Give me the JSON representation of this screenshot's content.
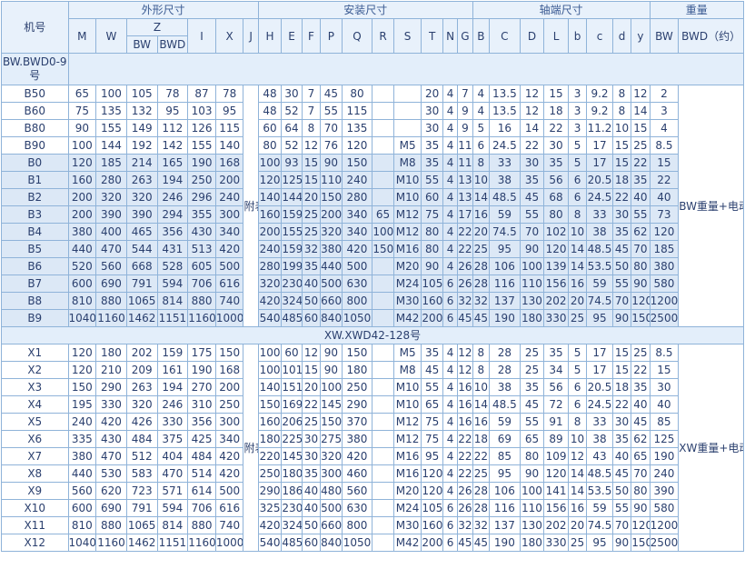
{
  "headers": {
    "model": "机号",
    "group_outer": "外形尺寸",
    "group_install": "安装尺寸",
    "group_shaft": "轴端尺寸",
    "group_weight": "重量",
    "M": "M",
    "W": "W",
    "Z": "Z",
    "Z_BW": "BW",
    "Z_BWD": "BWD",
    "I": "I",
    "X": "X",
    "J": "J",
    "H": "H",
    "E": "E",
    "F": "F",
    "P": "P",
    "Q": "Q",
    "R": "R",
    "S": "S",
    "T": "T",
    "N": "N",
    "G": "G",
    "B": "B",
    "C": "C",
    "D": "D",
    "L": "L",
    "b": "b",
    "c": "c",
    "d": "d",
    "y": "y",
    "W_BW": "BW",
    "W_BWD": "BWD（约）"
  },
  "section1": {
    "title": "BW.BWD0-9号",
    "j_note": "附表",
    "weight_note": "BW重量+电动机重量",
    "rows": [
      [
        "B50",
        "65",
        "100",
        "105",
        "78",
        "87",
        "78",
        "48",
        "30",
        "7",
        "45",
        "80",
        "",
        "",
        "20",
        "4",
        "7",
        "4",
        "13.5",
        "12",
        "15",
        "3",
        "9.2",
        "8",
        "12",
        "2"
      ],
      [
        "B60",
        "75",
        "135",
        "132",
        "95",
        "103",
        "95",
        "48",
        "52",
        "7",
        "55",
        "115",
        "",
        "",
        "30",
        "4",
        "9",
        "4",
        "13.5",
        "12",
        "18",
        "3",
        "9.2",
        "8",
        "14",
        "3"
      ],
      [
        "B80",
        "90",
        "155",
        "149",
        "112",
        "126",
        "115",
        "60",
        "64",
        "8",
        "70",
        "135",
        "",
        "",
        "30",
        "4",
        "9",
        "5",
        "16",
        "14",
        "22",
        "3",
        "11.2",
        "10",
        "15",
        "4"
      ],
      [
        "B90",
        "100",
        "144",
        "192",
        "142",
        "155",
        "140",
        "80",
        "52",
        "12",
        "76",
        "120",
        "",
        "M5",
        "35",
        "4",
        "11",
        "6",
        "24.5",
        "22",
        "30",
        "5",
        "17",
        "15",
        "25",
        "8.5"
      ],
      [
        "B0",
        "120",
        "185",
        "214",
        "165",
        "190",
        "168",
        "100",
        "93",
        "15",
        "90",
        "150",
        "",
        "M8",
        "35",
        "4",
        "11",
        "8",
        "33",
        "30",
        "35",
        "5",
        "17",
        "15",
        "22",
        "15"
      ],
      [
        "B1",
        "160",
        "280",
        "263",
        "194",
        "250",
        "200",
        "120",
        "125",
        "15",
        "110",
        "240",
        "",
        "M10",
        "55",
        "4",
        "13",
        "10",
        "38",
        "35",
        "56",
        "6",
        "20.5",
        "18",
        "35",
        "22"
      ],
      [
        "B2",
        "200",
        "320",
        "320",
        "246",
        "296",
        "240",
        "140",
        "144",
        "20",
        "150",
        "280",
        "",
        "M10",
        "60",
        "4",
        "13",
        "14",
        "48.5",
        "45",
        "68",
        "6",
        "24.5",
        "22",
        "40",
        "40"
      ],
      [
        "B3",
        "200",
        "390",
        "390",
        "294",
        "355",
        "300",
        "160",
        "159",
        "25",
        "200",
        "340",
        "65",
        "M12",
        "75",
        "4",
        "17",
        "16",
        "59",
        "55",
        "80",
        "8",
        "33",
        "30",
        "55",
        "73"
      ],
      [
        "B4",
        "380",
        "400",
        "465",
        "356",
        "430",
        "340",
        "200",
        "155",
        "25",
        "320",
        "340",
        "100",
        "M12",
        "80",
        "4",
        "22",
        "20",
        "74.5",
        "70",
        "102",
        "10",
        "38",
        "35",
        "62",
        "120"
      ],
      [
        "B5",
        "440",
        "470",
        "544",
        "431",
        "513",
        "420",
        "240",
        "159",
        "32",
        "380",
        "420",
        "150",
        "M16",
        "80",
        "4",
        "22",
        "25",
        "95",
        "90",
        "120",
        "14",
        "48.5",
        "45",
        "70",
        "185"
      ],
      [
        "B6",
        "520",
        "560",
        "668",
        "528",
        "605",
        "500",
        "280",
        "199",
        "35",
        "440",
        "500",
        "",
        "M20",
        "90",
        "4",
        "26",
        "28",
        "106",
        "100",
        "139",
        "14",
        "53.5",
        "50",
        "80",
        "380"
      ],
      [
        "B7",
        "600",
        "690",
        "791",
        "594",
        "706",
        "616",
        "320",
        "230",
        "40",
        "500",
        "630",
        "",
        "M24",
        "105",
        "6",
        "26",
        "28",
        "116",
        "110",
        "156",
        "16",
        "59",
        "55",
        "90",
        "580"
      ],
      [
        "B8",
        "810",
        "880",
        "1065",
        "814",
        "880",
        "740",
        "420",
        "324",
        "50",
        "660",
        "800",
        "",
        "M30",
        "160",
        "6",
        "32",
        "32",
        "137",
        "130",
        "202",
        "20",
        "74.5",
        "70",
        "120",
        "1200"
      ],
      [
        "B9",
        "1040",
        "1160",
        "1462",
        "1151",
        "1160",
        "1000",
        "540",
        "485",
        "60",
        "840",
        "1050",
        "",
        "M42",
        "200",
        "6",
        "45",
        "45",
        "190",
        "180",
        "330",
        "25",
        "95",
        "90",
        "150",
        "2500"
      ]
    ]
  },
  "section2": {
    "title": "XW.XWD42-128号",
    "j_note": "附表",
    "weight_note": "XW重量+电动机重量",
    "rows": [
      [
        "X1",
        "120",
        "180",
        "202",
        "159",
        "175",
        "150",
        "100",
        "60",
        "12",
        "90",
        "150",
        "",
        "M5",
        "35",
        "4",
        "12",
        "8",
        "28",
        "25",
        "35",
        "5",
        "17",
        "15",
        "25",
        "8.5"
      ],
      [
        "X2",
        "120",
        "210",
        "209",
        "161",
        "190",
        "168",
        "100",
        "101",
        "15",
        "90",
        "180",
        "",
        "M8",
        "45",
        "4",
        "12",
        "8",
        "28",
        "25",
        "34",
        "5",
        "17",
        "15",
        "22",
        "15"
      ],
      [
        "X3",
        "150",
        "290",
        "263",
        "194",
        "270",
        "200",
        "140",
        "151",
        "20",
        "100",
        "250",
        "",
        "M10",
        "55",
        "4",
        "16",
        "10",
        "38",
        "35",
        "56",
        "6",
        "20.5",
        "18",
        "35",
        "30"
      ],
      [
        "X4",
        "195",
        "330",
        "320",
        "246",
        "310",
        "250",
        "150",
        "169",
        "22",
        "145",
        "290",
        "",
        "M10",
        "65",
        "4",
        "16",
        "14",
        "48.5",
        "45",
        "72",
        "6",
        "24.5",
        "22",
        "40",
        "40"
      ],
      [
        "X5",
        "240",
        "420",
        "426",
        "330",
        "356",
        "300",
        "160",
        "206",
        "25",
        "150",
        "370",
        "",
        "M12",
        "75",
        "4",
        "16",
        "16",
        "59",
        "55",
        "91",
        "8",
        "33",
        "30",
        "45",
        "85"
      ],
      [
        "X6",
        "335",
        "430",
        "484",
        "375",
        "425",
        "340",
        "180",
        "225",
        "30",
        "275",
        "380",
        "",
        "M12",
        "75",
        "4",
        "22",
        "18",
        "69",
        "65",
        "89",
        "10",
        "38",
        "35",
        "62",
        "125"
      ],
      [
        "X7",
        "380",
        "470",
        "512",
        "404",
        "484",
        "420",
        "220",
        "145",
        "30",
        "320",
        "420",
        "",
        "M16",
        "95",
        "4",
        "22",
        "22",
        "85",
        "80",
        "109",
        "12",
        "43",
        "40",
        "65",
        "190"
      ],
      [
        "X8",
        "440",
        "530",
        "583",
        "470",
        "514",
        "420",
        "250",
        "180",
        "35",
        "300",
        "460",
        "",
        "M16",
        "120",
        "4",
        "22",
        "25",
        "95",
        "90",
        "120",
        "14",
        "48.5",
        "45",
        "70",
        "240"
      ],
      [
        "X9",
        "560",
        "620",
        "723",
        "571",
        "614",
        "500",
        "290",
        "186",
        "40",
        "480",
        "560",
        "",
        "M20",
        "120",
        "4",
        "26",
        "28",
        "106",
        "100",
        "141",
        "14",
        "53.5",
        "50",
        "80",
        "390"
      ],
      [
        "X10",
        "600",
        "690",
        "791",
        "594",
        "706",
        "616",
        "325",
        "230",
        "40",
        "500",
        "630",
        "",
        "M24",
        "105",
        "6",
        "26",
        "28",
        "116",
        "110",
        "156",
        "16",
        "59",
        "55",
        "90",
        "580"
      ],
      [
        "X11",
        "810",
        "880",
        "1065",
        "814",
        "880",
        "740",
        "420",
        "324",
        "50",
        "660",
        "800",
        "",
        "M30",
        "160",
        "6",
        "32",
        "32",
        "137",
        "130",
        "202",
        "20",
        "74.5",
        "70",
        "120",
        "1200"
      ],
      [
        "X12",
        "1040",
        "1160",
        "1462",
        "1151",
        "1160",
        "1000",
        "540",
        "485",
        "60",
        "840",
        "1050",
        "",
        "M42",
        "200",
        "6",
        "45",
        "45",
        "190",
        "180",
        "330",
        "25",
        "95",
        "90",
        "150",
        "2500"
      ]
    ]
  }
}
